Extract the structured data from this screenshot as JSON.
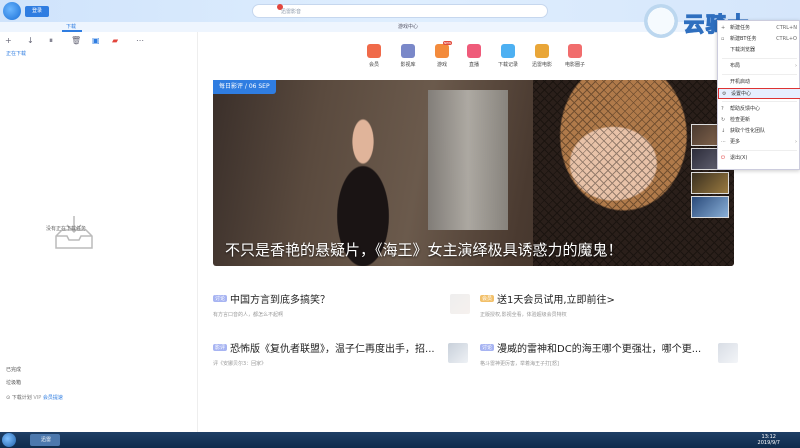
{
  "titlebar": {
    "login_label": "登录",
    "search_placeholder": "迅雷影音",
    "window_controls": [
      "minimize-icon",
      "maximize-icon",
      "close-icon"
    ]
  },
  "tabs": [
    {
      "label": "下载",
      "active": true
    },
    {
      "label": "游戏中心",
      "active": false
    }
  ],
  "sidebar": {
    "toolbar": [
      "add-icon",
      "download-icon",
      "pause-icon",
      "delete-icon",
      "save-icon",
      "boost-icon",
      "more-icon"
    ],
    "section_label": "正在下载",
    "empty_text": "没有正在下载任务",
    "completed_label": "已完成",
    "trash_label": "垃圾箱",
    "footer": {
      "label": "下载计划",
      "vip": "VIP",
      "link": "会员提速"
    }
  },
  "nav": [
    {
      "label": "会员",
      "color": "#f06a4a"
    },
    {
      "label": "影视库",
      "color": "#7a88c9"
    },
    {
      "label": "游戏",
      "color": "#f38b3c",
      "badge": "NEW"
    },
    {
      "label": "直播",
      "color": "#ef5b7a"
    },
    {
      "label": "下载记录",
      "color": "#4db0f2"
    },
    {
      "label": "迅雷电影",
      "color": "#e9a638"
    },
    {
      "label": "电影圈子",
      "color": "#f16d6d"
    }
  ],
  "hero": {
    "tag": "每日影评 / 06 SEP",
    "title": "不只是香艳的悬疑片，《海王》女主演绎极具诱惑力的魔鬼！"
  },
  "news": [
    {
      "tag": "讨论",
      "tag_color": "#a7b4f2",
      "title": "中国方言到底多搞笑？",
      "sub": "有方言口音的人，都怎么不起啊"
    },
    {
      "tag": "会员",
      "tag_color": "#f2c06a",
      "title": "送1天会员试用,立即前往>",
      "sub": "正版授权,影视全看，体验超级会员特权"
    },
    {
      "tag": "影评",
      "tag_color": "#a7b4f2",
      "title": "恐怖版《复仇者联盟》，温子仁再度出手，招...",
      "sub": "评《安娜贝尔3：回家》"
    },
    {
      "tag": "讨论",
      "tag_color": "#a7b4f2",
      "title": "漫威的雷神和DC的海王哪个更强壮，哪个更...",
      "sub": "格斗雷神更厉害，举着海王子打[怒]"
    }
  ],
  "menu": {
    "items": [
      {
        "label": "新建任务",
        "shortcut": "CTRL+N",
        "icon": "new-task-icon"
      },
      {
        "label": "新建BT任务",
        "shortcut": "CTRL+O",
        "icon": "bt-task-icon"
      },
      {
        "label": "下载浏览器",
        "shortcut": "",
        "icon": "browser-icon"
      },
      {
        "label": "布局",
        "shortcut": "",
        "icon": "layout-icon",
        "submenu": true
      },
      {
        "label": "开机启动",
        "shortcut": "",
        "icon": "startup-icon"
      },
      {
        "label": "设置中心",
        "shortcut": "",
        "icon": "settings-icon",
        "highlight": true
      },
      {
        "label": "帮助反馈中心",
        "shortcut": "",
        "icon": "help-icon"
      },
      {
        "label": "检查更新",
        "shortcut": "",
        "icon": "update-icon"
      },
      {
        "label": "获取个性化团队",
        "shortcut": "",
        "icon": "download-icon"
      },
      {
        "label": "更多",
        "shortcut": "",
        "icon": "more-icon",
        "submenu": true
      },
      {
        "label": "退出(X)",
        "shortcut": "",
        "icon": "power-icon"
      }
    ]
  },
  "watermark": {
    "text": "云骑士"
  },
  "taskbar": {
    "app_label": "迅雷",
    "time": "13:12",
    "date": "2019/9/7"
  }
}
